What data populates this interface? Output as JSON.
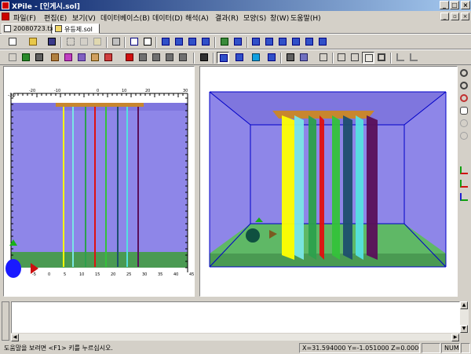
{
  "window": {
    "title": "XPile - [인게시.sol]",
    "minimize_glyph": "_",
    "maximize_glyph": "□",
    "close_glyph": "×",
    "mdi_minimize_glyph": "_",
    "mdi_restore_glyph": "▫",
    "mdi_close_glyph": "×"
  },
  "menu": [
    {
      "label": "파일(F)"
    },
    {
      "label": "편집(E)"
    },
    {
      "label": "보기(V)"
    },
    {
      "label": "데이터베이스(B)"
    },
    {
      "label": "데이터(D)"
    },
    {
      "label": "해석(A)"
    },
    {
      "label": "결과(R)"
    },
    {
      "label": "모양(S)"
    },
    {
      "label": "창(W)"
    },
    {
      "label": "도움말(H)"
    }
  ],
  "tabs": [
    {
      "label": "20080723.txt"
    },
    {
      "label": "유등제.sol"
    }
  ],
  "left_view": {
    "ruler_labels": [
      "-30",
      "-20",
      "-10",
      "0",
      "10",
      "20",
      "30"
    ],
    "bottom_labels": [
      "-5",
      "0",
      "5",
      "10",
      "15",
      "20",
      "25",
      "30",
      "35",
      "40",
      "45"
    ]
  },
  "colors": {
    "sky": "#ffffff",
    "water": "#8e86e8",
    "water_dark": "#7f76de",
    "ground": "#4a9a52",
    "ground_light": "#5fb866",
    "cap": "#c8862e",
    "piles": [
      "#ffff00",
      "#7ae6e6",
      "#2ca04c",
      "#e01010",
      "#34c23a",
      "#1e4e6e",
      "#55e0e0",
      "#5a0f5a"
    ],
    "frame": "#0000c8"
  },
  "output": {
    "text": ""
  },
  "status": {
    "message": "도움말을 보려면 <F1> 키를 누르십시오.",
    "coords": "X=31.594000 Y=-1.051000 Z=0.000000",
    "num": "NUM"
  }
}
